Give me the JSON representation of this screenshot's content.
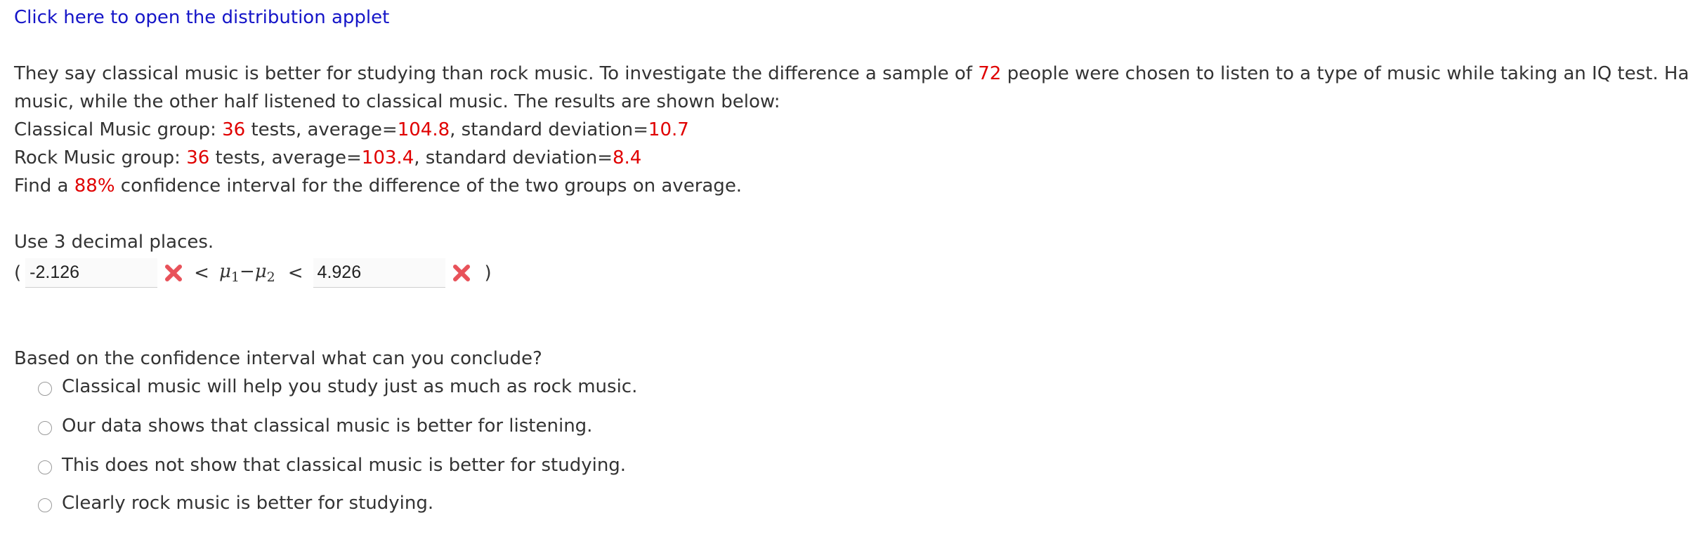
{
  "applet_link": "Click here to open the distribution applet",
  "problem": {
    "intro_pre": "They say classical music is better for studying than rock music. To investigate the difference a sample of ",
    "sample_size": "72",
    "intro_post": " people were chosen to listen to a type of music while taking an IQ test. Ha",
    "line2": "music, while the other half listened to classical music. The results are shown below:",
    "classical": {
      "label": "Classical Music group: ",
      "n": "36",
      "t1": " tests, average=",
      "mean": "104.8",
      "t2": ", standard deviation=",
      "sd": "10.7"
    },
    "rock": {
      "label": "Rock Music group: ",
      "n": "36",
      "t1": " tests, average=",
      "mean": "103.4",
      "t2": ", standard deviation=",
      "sd": "8.4"
    },
    "find_pre": "Find a ",
    "confidence": "88%",
    "find_post": " confidence interval for the difference of the two groups on average."
  },
  "decimals_note": "Use 3 decimal places.",
  "interval": {
    "open_paren": "(",
    "lower_value": "-2.126",
    "less_than_1": "<",
    "mu1": "μ",
    "sub1": "1",
    "minus": "−",
    "mu2": "μ",
    "sub2": "2",
    "less_than_2": "<",
    "upper_value": "4.926",
    "close_paren": ")",
    "status": "incorrect",
    "mark_color": "#e8525a"
  },
  "question": {
    "prompt": "Based on the confidence interval what can you conclude?",
    "options": [
      "Classical music will help you study just as much as rock music.",
      "Our data shows that classical music is better for listening.",
      "This does not show that classical music is better for studying.",
      "Clearly rock music is better for studying."
    ]
  }
}
